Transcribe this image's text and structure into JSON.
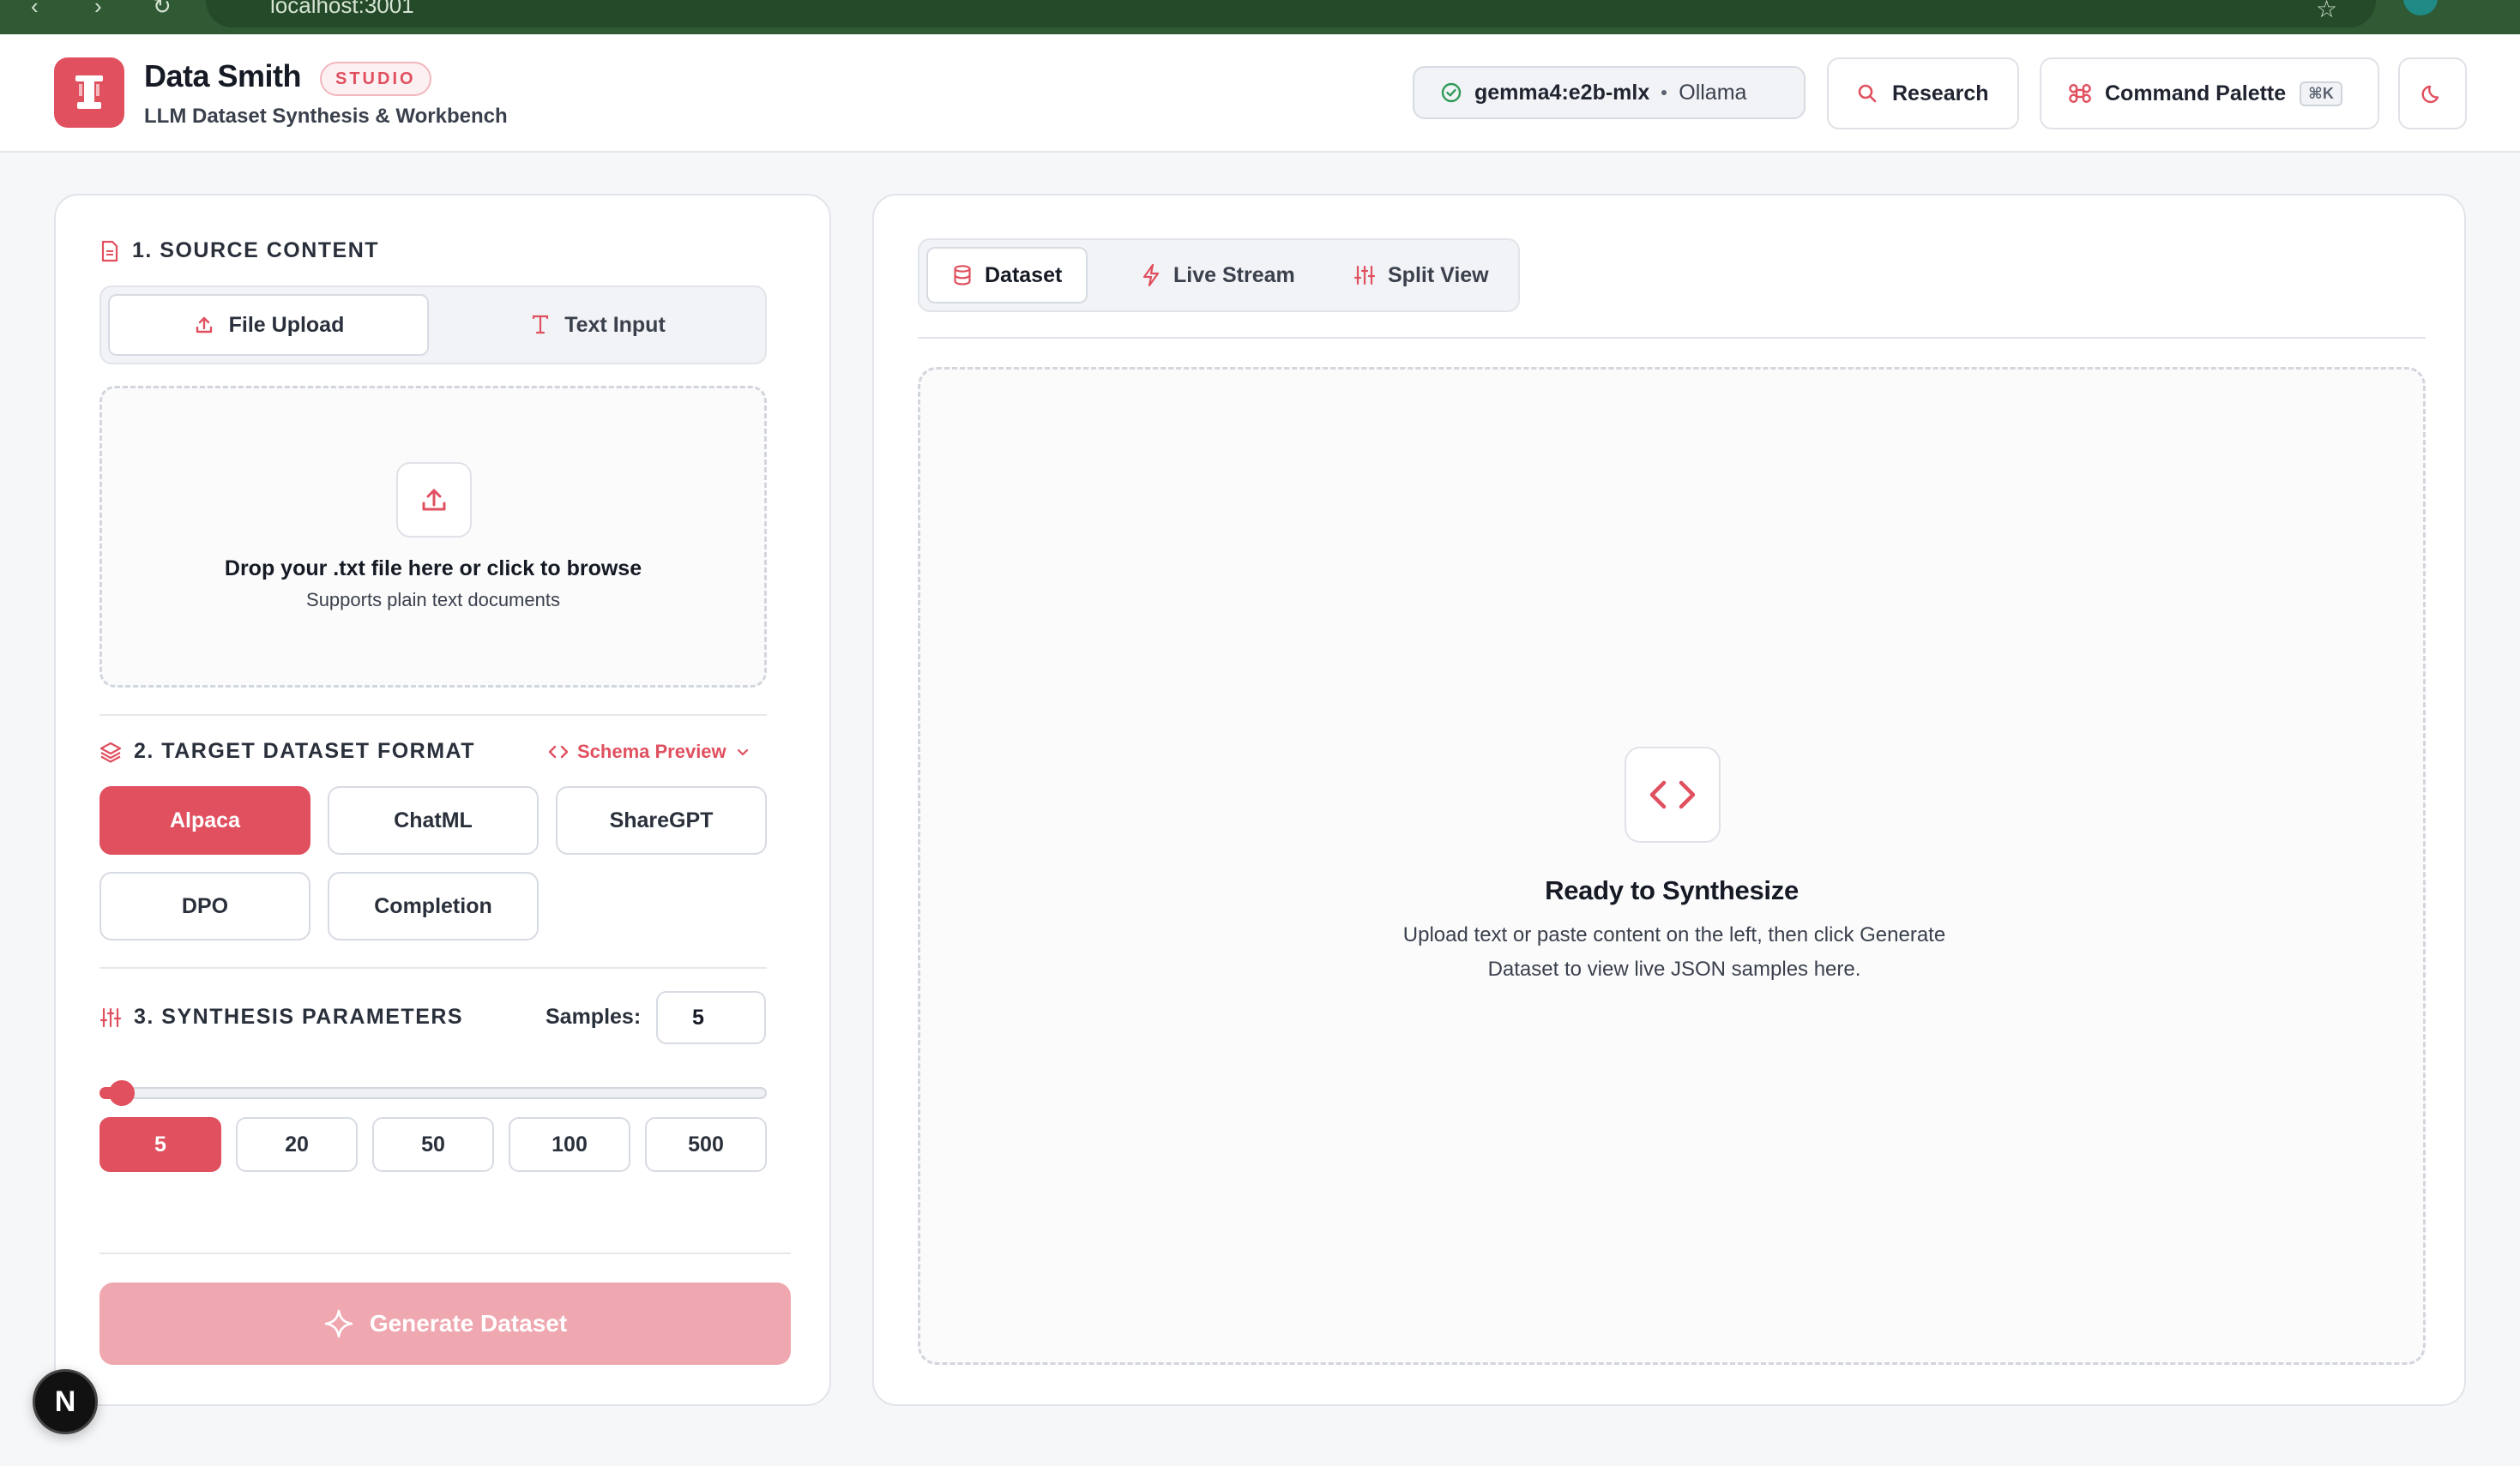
{
  "browser": {
    "url": "localhost:3001"
  },
  "header": {
    "brand_name": "Data Smith",
    "badge": "STUDIO",
    "subtitle": "LLM Dataset Synthesis & Workbench",
    "model": {
      "name": "gemma4:e2b-mlx",
      "provider": "Ollama",
      "status_icon": "check-circle-icon"
    },
    "research_label": "Research",
    "palette_label": "Command Palette",
    "palette_shortcut": "⌘K",
    "theme_icon": "moon-icon"
  },
  "source": {
    "title": "1. SOURCE CONTENT",
    "tabs": [
      "File Upload",
      "Text Input"
    ],
    "active_tab": "File Upload",
    "drop_title": "Drop your .txt file here or click to browse",
    "drop_sub": "Supports plain text documents"
  },
  "format": {
    "title": "2. TARGET DATASET FORMAT",
    "schema_preview": "Schema Preview",
    "options": [
      "Alpaca",
      "ChatML",
      "ShareGPT",
      "DPO",
      "Completion"
    ],
    "selected": "Alpaca"
  },
  "params": {
    "title": "3. SYNTHESIS PARAMETERS",
    "samples_label": "Samples:",
    "samples_value": "5",
    "slider_min": 5,
    "slider_max": 500,
    "slider_value": 5,
    "presets": [
      "5",
      "20",
      "50",
      "100",
      "500"
    ],
    "selected_preset": "5"
  },
  "generate_label": "Generate Dataset",
  "output": {
    "tabs": [
      "Dataset",
      "Live Stream",
      "Split View"
    ],
    "active_tab": "Dataset",
    "empty_title": "Ready to Synthesize",
    "empty_line1": "Upload text or paste content on the left, then click Generate",
    "empty_line2": "Dataset to view live JSON samples here."
  },
  "next_badge": "N",
  "colors": {
    "accent": "#e0505f",
    "accent_light": "#efa7b0",
    "browser_bar": "#2f5a33"
  }
}
